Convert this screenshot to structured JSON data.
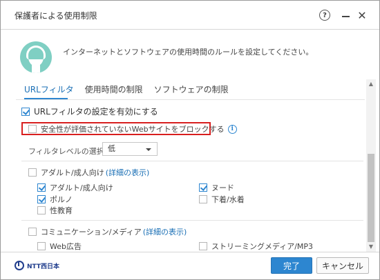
{
  "window": {
    "title": "保護者による使用制限"
  },
  "titlebar": {
    "help_label": "?",
    "close_label": "✕"
  },
  "intro": {
    "text": "インターネットとソフトウェアの使用時間のルールを設定してください。"
  },
  "tabs": [
    {
      "label": "URLフィルタ",
      "active": true
    },
    {
      "label": "使用時間の制限",
      "active": false
    },
    {
      "label": "ソフトウェアの制限",
      "active": false
    }
  ],
  "url_filter": {
    "enable_label": "URLフィルタの設定を有効にする",
    "enable_checked": true,
    "block_unrated_label": "安全性が評価されていないWebサイトをブロックする",
    "block_unrated_checked": false,
    "info_icon_glyph": "i",
    "level_label": "フィルタレベルの選択:",
    "level_value": "低"
  },
  "categories": [
    {
      "label": "アダルト/成人向け",
      "detail_link": "(詳細の表示)",
      "checked": false,
      "items": [
        {
          "label": "アダルト/成人向け",
          "checked": true
        },
        {
          "label": "ヌード",
          "checked": true
        },
        {
          "label": "ポルノ",
          "checked": true
        },
        {
          "label": "下着/水着",
          "checked": false
        },
        {
          "label": "性教育",
          "checked": false
        }
      ]
    },
    {
      "label": "コミュニケーション/メディア",
      "detail_link": "(詳細の表示)",
      "checked": false,
      "items": [
        {
          "label": "Web広告",
          "checked": false
        },
        {
          "label": "ストリーミングメディア/MP3",
          "checked": false
        }
      ]
    }
  ],
  "footer": {
    "logo_text": "NTT西日本",
    "ok_label": "完了",
    "cancel_label": "キャンセル"
  },
  "colors": {
    "accent": "#2d86d0",
    "highlight_border": "#d81e1e",
    "avatar": "#7fcfc3"
  }
}
